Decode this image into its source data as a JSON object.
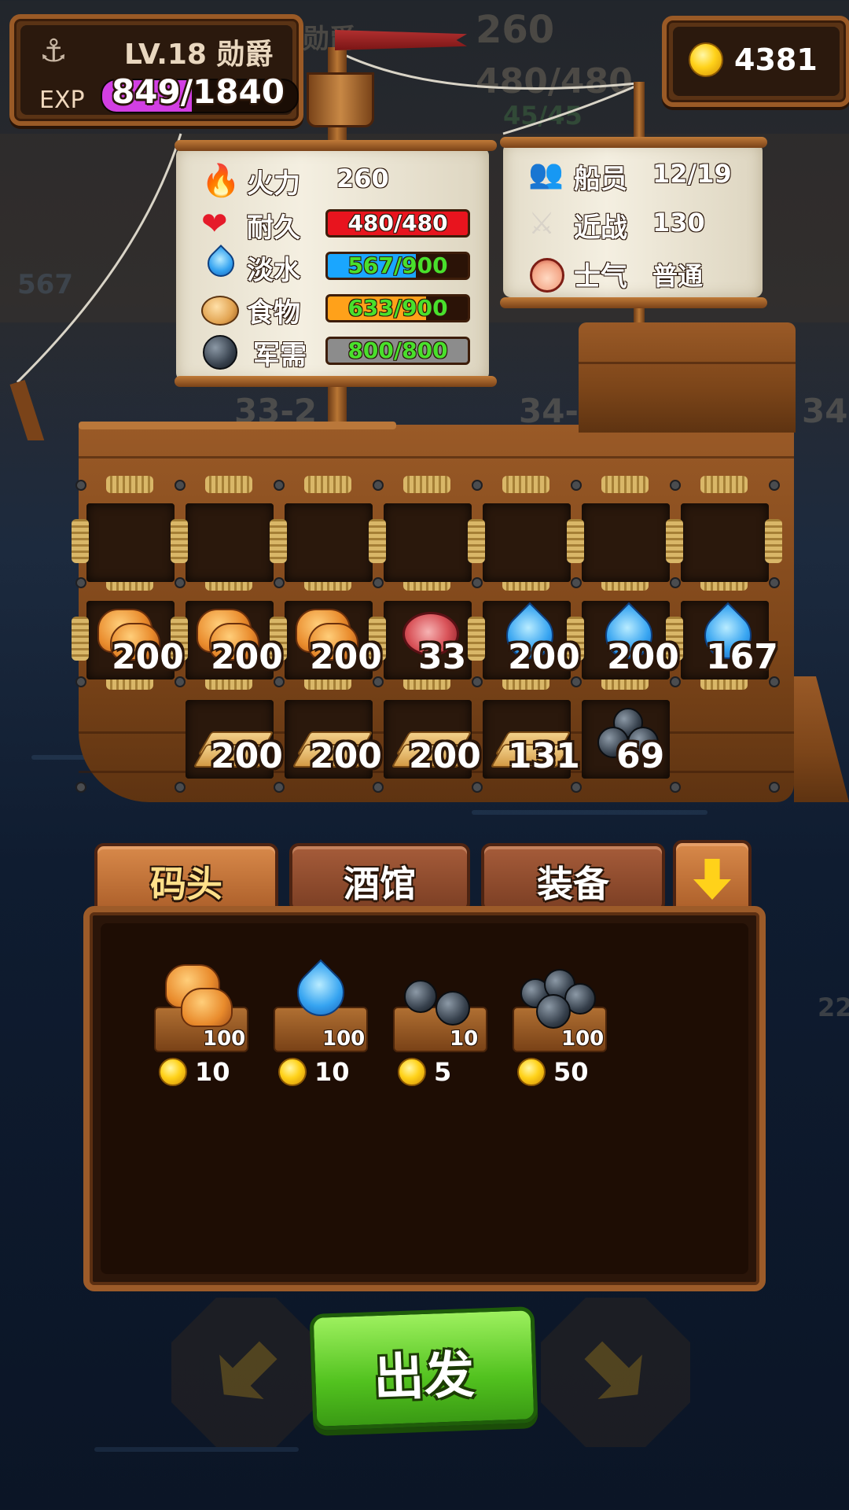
{
  "background": {
    "ghost_title": "勋爵",
    "ghost_firepower": "260",
    "ghost_hp": "480/480",
    "ghost_green": "45/45",
    "ghost_water": "567",
    "ghost_level_left": "33-2",
    "ghost_level_right": "34-",
    "ghost_level_far": "34",
    "ghost_num_right": "22"
  },
  "player": {
    "level_text": "LV.18 勋爵",
    "exp_label": "EXP",
    "exp_text": "849/1840",
    "exp_progress": 0.461,
    "gold": "4381"
  },
  "ship_stats_left": {
    "firepower_label": "火力",
    "firepower_value": "260",
    "durability_label": "耐久",
    "durability_text": "480/480",
    "durability_progress": 1.0,
    "water_label": "淡水",
    "water_text": "567/900",
    "water_progress": 0.63,
    "food_label": "食物",
    "food_text": "633/900",
    "food_progress": 0.703,
    "supplies_label": "军需",
    "supplies_text": "800/800",
    "supplies_progress": 1.0
  },
  "ship_stats_right": {
    "crew_label": "船员",
    "crew_value": "12/19",
    "melee_label": "近战",
    "melee_value": "130",
    "morale_label": "士气",
    "morale_value": "普通"
  },
  "cargo": {
    "row2": [
      {
        "icon": "bread-icon",
        "value": "200"
      },
      {
        "icon": "bread-icon",
        "value": "200"
      },
      {
        "icon": "bread-icon",
        "value": "200"
      },
      {
        "icon": "meat-icon",
        "value": "33"
      },
      {
        "icon": "water-drop-icon",
        "value": "200"
      },
      {
        "icon": "water-drop-icon",
        "value": "200"
      },
      {
        "icon": "water-drop-icon",
        "value": "167"
      }
    ],
    "row3": [
      {
        "icon": "lumber-icon",
        "value": "200"
      },
      {
        "icon": "lumber-icon",
        "value": "200"
      },
      {
        "icon": "lumber-icon",
        "value": "200"
      },
      {
        "icon": "lumber-icon",
        "value": "131"
      },
      {
        "icon": "cannonball-icon",
        "value": "69"
      }
    ]
  },
  "tabs": {
    "dock": "码头",
    "tavern": "酒馆",
    "equipment": "装备"
  },
  "market": [
    {
      "name": "bread-crate",
      "qty": "100",
      "price": "10"
    },
    {
      "name": "water-crate",
      "qty": "100",
      "price": "10"
    },
    {
      "name": "cannonball-crate-small",
      "qty": "10",
      "price": "5"
    },
    {
      "name": "cannonball-crate-large",
      "qty": "100",
      "price": "50"
    }
  ],
  "depart_label": "出发",
  "colors": {
    "exp_fill": "#d23fe3",
    "hp_fill": "#e8141e",
    "water_fill": "#1aa6ff",
    "food_fill": "#ffa11a",
    "supplies_fill": "#8c8c8c",
    "bar_text_green": "#49e02c",
    "depart_green": "#52c21f"
  }
}
